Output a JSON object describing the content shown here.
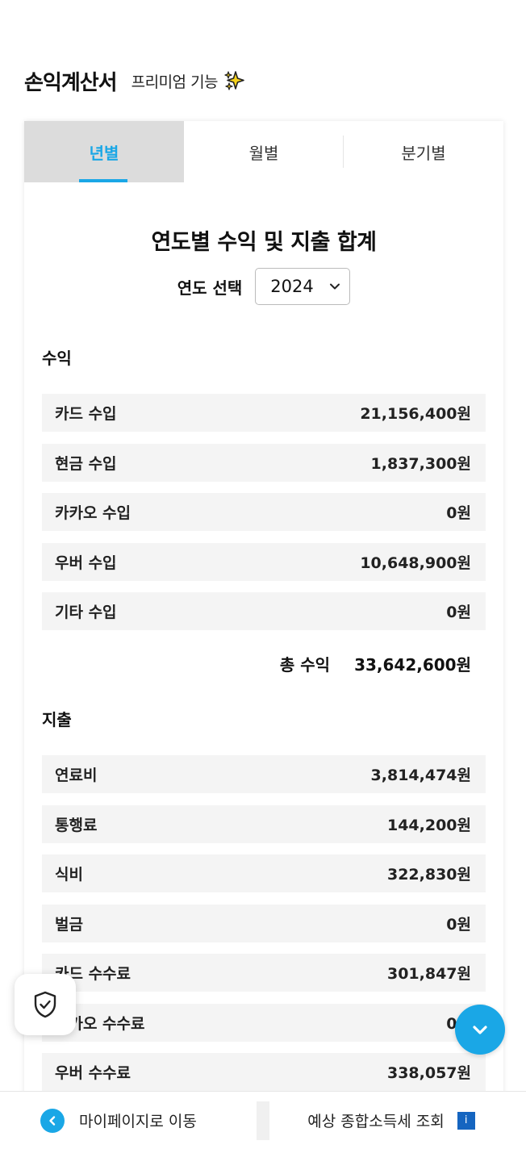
{
  "header": {
    "title": "손익계산서",
    "subtitle": "프리미엄 기능"
  },
  "tabs": [
    {
      "label": "년별",
      "active": true
    },
    {
      "label": "월별",
      "active": false
    },
    {
      "label": "분기별",
      "active": false
    }
  ],
  "main": {
    "section_title": "연도별 수익 및 지출 합계",
    "year_label": "연도 선택",
    "year_value": "2024"
  },
  "income": {
    "label": "수익",
    "rows": [
      {
        "name": "카드 수입",
        "value": "21,156,400원"
      },
      {
        "name": "현금 수입",
        "value": "1,837,300원"
      },
      {
        "name": "카카오 수입",
        "value": "0원"
      },
      {
        "name": "우버 수입",
        "value": "10,648,900원"
      },
      {
        "name": "기타 수입",
        "value": "0원"
      }
    ],
    "total_label": "총 수익",
    "total_value": "33,642,600원"
  },
  "expense": {
    "label": "지출",
    "rows": [
      {
        "name": "연료비",
        "value": "3,814,474원"
      },
      {
        "name": "통행료",
        "value": "144,200원"
      },
      {
        "name": "식비",
        "value": "322,830원"
      },
      {
        "name": "벌금",
        "value": "0원"
      },
      {
        "name": "카드 수수료",
        "value": "301,847원"
      },
      {
        "name": "카카오 수수료",
        "value": "0원"
      },
      {
        "name": "우버 수수료",
        "value": "338,057원"
      }
    ]
  },
  "bottom_bar": {
    "left_label": "마이페이지로 이동",
    "right_label": "예상 종합소득세 조회",
    "info_glyph": "i"
  },
  "colors": {
    "accent": "#1aa7e6",
    "tab_active_bg": "#dcdcdc",
    "row_bg": "#f4f4f4"
  }
}
